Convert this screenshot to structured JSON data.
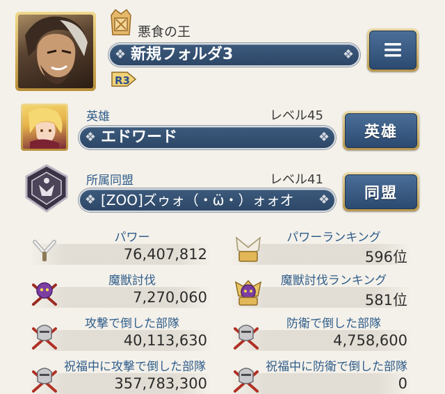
{
  "profile": {
    "title": "悪食の王",
    "folder_name": "新規フォルダ3",
    "rank_badge": "R3",
    "menu_icon": "hamburger-menu-icon"
  },
  "hero": {
    "label": "英雄",
    "level": "レベル45",
    "name": "エドワード",
    "button_label": "英雄"
  },
  "alliance": {
    "label": "所属同盟",
    "level": "レベル41",
    "name": "[ZOO]ズゥォ（・ω̈・）ォォオ",
    "button_label": "同盟"
  },
  "stats": {
    "power": {
      "title": "パワー",
      "value": "76,407,812",
      "icon": "crossed-swords-icon"
    },
    "power_ranking": {
      "title": "パワーランキング",
      "value": "596位",
      "icon": "gold-swords-crest-icon"
    },
    "beast": {
      "title": "魔獣討伐",
      "value": "7,270,060",
      "icon": "purple-beast-icon"
    },
    "beast_ranking": {
      "title": "魔獣討伐ランキング",
      "value": "581位",
      "icon": "purple-beast-crest-icon"
    },
    "attack_kills": {
      "title": "攻撃で倒した部隊",
      "value": "40,113,630",
      "icon": "knight-attack-icon"
    },
    "defense_kills": {
      "title": "防衛で倒した部隊",
      "value": "4,758,600",
      "icon": "knight-defense-icon"
    },
    "blessed_attack_kills": {
      "title": "祝福中に攻撃で倒した部隊",
      "value": "357,783,300",
      "icon": "knight-blessed-attack-icon"
    },
    "blessed_defense_kills": {
      "title": "祝福中に防衛で倒した部隊",
      "value": "0",
      "icon": "knight-blessed-defense-icon"
    }
  },
  "colors": {
    "bar": "#2d4767",
    "label_blue": "#2f5d8a",
    "gold": "#c9a659",
    "background": "#f4f1ea"
  }
}
